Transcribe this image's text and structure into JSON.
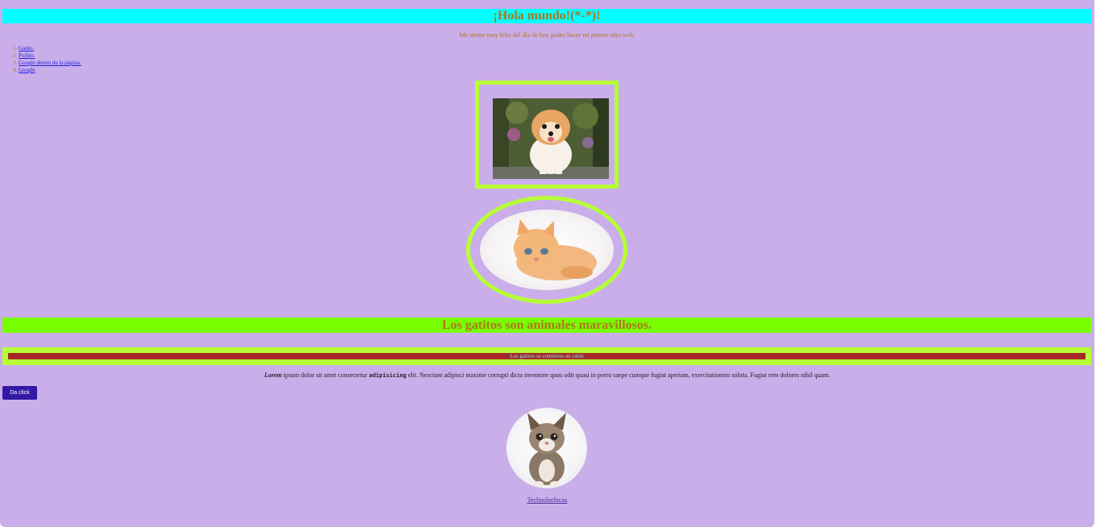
{
  "header": {
    "title": "¡Hola mundo!(*-*)!",
    "subtitle": "Me siento muy feliz del día de hoy poder hacer mi primer sitio web."
  },
  "links": [
    {
      "label": "Gatito."
    },
    {
      "label": "Pollito."
    },
    {
      "label": "Google dentro de la página."
    },
    {
      "label": "Google"
    }
  ],
  "section": {
    "heading": "Los gatitos son animales maravillosos.",
    "banner_text": "Los gatitos se comieron un ratón"
  },
  "paragraph": {
    "lead_em": "Lorem",
    "part1": " ipsum dolor sit amet consectetur ",
    "strong": "adipisicing",
    "part2": " elit. Nesciunt adipisci maxime corrupti dicta inventore quos odit quasi in porro saepe cumque fugiat aperiam, exercitationem soluta. Fugiat rem dolores nihil quam."
  },
  "button": {
    "label": "Da click"
  },
  "footer": {
    "link_label": "Technolochicas"
  },
  "colors": {
    "background": "#caaeea",
    "title_bar": "#00ffff",
    "heading_bar": "#77ff00",
    "frame_border": "#b6ff35",
    "banner": "#a6282a",
    "heading_text": "#b0761e",
    "button": "#3319a6"
  }
}
